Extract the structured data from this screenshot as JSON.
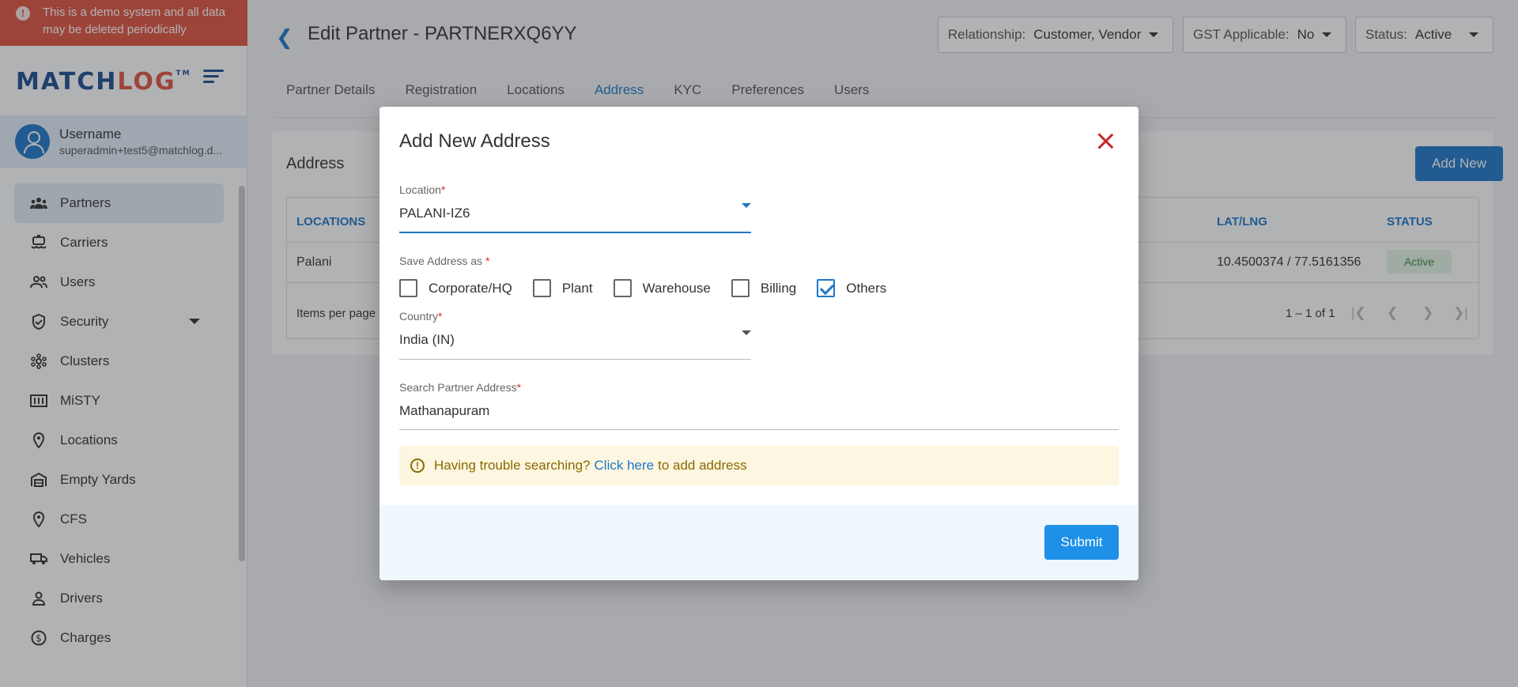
{
  "banner": {
    "text": "This is a demo system and all data may be deleted periodically"
  },
  "logo": {
    "part1": "MATCH",
    "part2": "LOG",
    "tm": "TM"
  },
  "user": {
    "name": "Username",
    "email": "superadmin+test5@matchlog.d..."
  },
  "sidebar": {
    "items": [
      {
        "label": "Partners",
        "icon": "partners-icon"
      },
      {
        "label": "Carriers",
        "icon": "carriers-icon"
      },
      {
        "label": "Users",
        "icon": "users-icon"
      },
      {
        "label": "Security",
        "icon": "shield-icon"
      },
      {
        "label": "Clusters",
        "icon": "clusters-icon"
      },
      {
        "label": "MiSTY",
        "icon": "misty-icon"
      },
      {
        "label": "Locations",
        "icon": "location-pin-icon"
      },
      {
        "label": "Empty Yards",
        "icon": "warehouse-icon"
      },
      {
        "label": "CFS",
        "icon": "location-pin-icon"
      },
      {
        "label": "Vehicles",
        "icon": "truck-icon"
      },
      {
        "label": "Drivers",
        "icon": "person-icon"
      },
      {
        "label": "Charges",
        "icon": "dollar-icon"
      }
    ]
  },
  "header": {
    "title": "Edit Partner - PARTNERXQ6YY",
    "relationship": {
      "label": "Relationship:",
      "value": "Customer, Vendor"
    },
    "gst": {
      "label": "GST Applicable:",
      "value": "No"
    },
    "status": {
      "label": "Status:",
      "value": "Active"
    }
  },
  "tabs": [
    "Partner Details",
    "Registration",
    "Locations",
    "Address",
    "KYC",
    "Preferences",
    "Users"
  ],
  "card": {
    "title": "Address",
    "add_new": "Add New",
    "columns": {
      "locations": "LOCATIONS",
      "latlng": "LAT/LNG",
      "status": "STATUS"
    },
    "row": {
      "location": "Palani",
      "latlng": "10.4500374 / 77.5161356",
      "status": "Active"
    },
    "items_per_page": "Items per page",
    "range": "1 – 1 of 1"
  },
  "modal": {
    "title": "Add New Address",
    "location": {
      "label": "Location",
      "value": "PALANI-IZ6"
    },
    "save_as": {
      "label": "Save Address as",
      "options": [
        {
          "label": "Corporate/HQ",
          "checked": false
        },
        {
          "label": "Plant",
          "checked": false
        },
        {
          "label": "Warehouse",
          "checked": false
        },
        {
          "label": "Billing",
          "checked": false
        },
        {
          "label": "Others",
          "checked": true
        }
      ]
    },
    "country": {
      "label": "Country",
      "value": "India (IN)"
    },
    "search": {
      "label": "Search Partner Address",
      "value": "Mathanapuram"
    },
    "hint": {
      "prefix": "Having trouble searching?",
      "link": "Click here",
      "suffix": "to add address"
    },
    "submit": "Submit",
    "required_mark": "*"
  },
  "colors": {
    "primary": "#1f78c8",
    "banner": "#e0543f",
    "danger": "#c62828"
  }
}
